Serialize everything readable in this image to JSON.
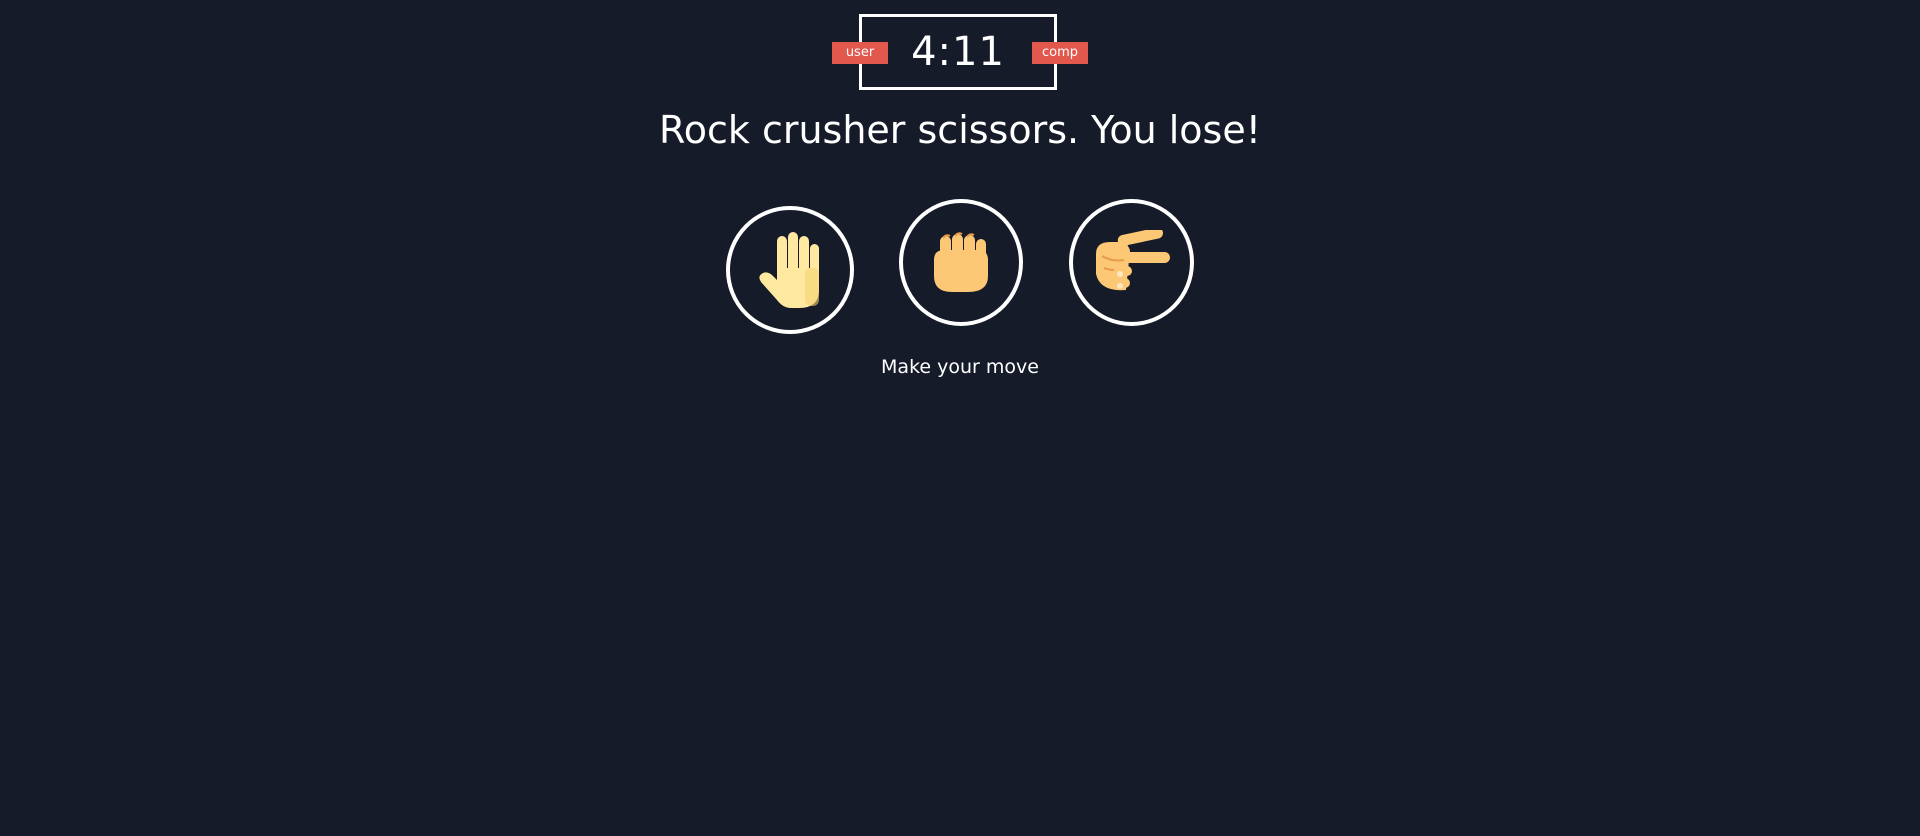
{
  "scoreboard": {
    "user_label": "user",
    "comp_label": "comp",
    "user_score": 4,
    "comp_score": 11,
    "score_text": "4:11"
  },
  "result_message": "Rock crusher scissors. You lose!",
  "choices": [
    {
      "label": "paper",
      "icon": "hand-paper-icon"
    },
    {
      "label": "rock",
      "icon": "fist-rock-icon"
    },
    {
      "label": "scissors",
      "icon": "hand-scissors-icon"
    }
  ],
  "status_text": "Make your move",
  "colors": {
    "background": "#151b28",
    "badge": "#e2584d",
    "ring": "#ffffff",
    "skin_light": "#ffe8a0",
    "skin_orange": "#fcc875"
  }
}
